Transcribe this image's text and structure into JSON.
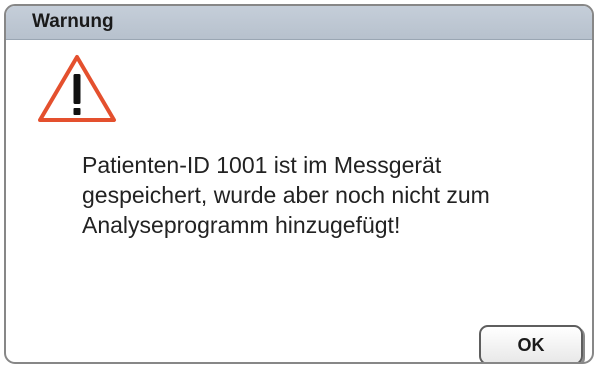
{
  "dialog": {
    "title": "Warnung",
    "icon": "warning-triangle-icon",
    "icon_color": "#e4502e",
    "message_lines": [
      "Patienten-ID 1001 ist im Messgerät",
      "gespeichert, wurde aber noch nicht zum",
      "Analyseprogramm hinzugefügt!"
    ],
    "ok_label": "OK"
  }
}
